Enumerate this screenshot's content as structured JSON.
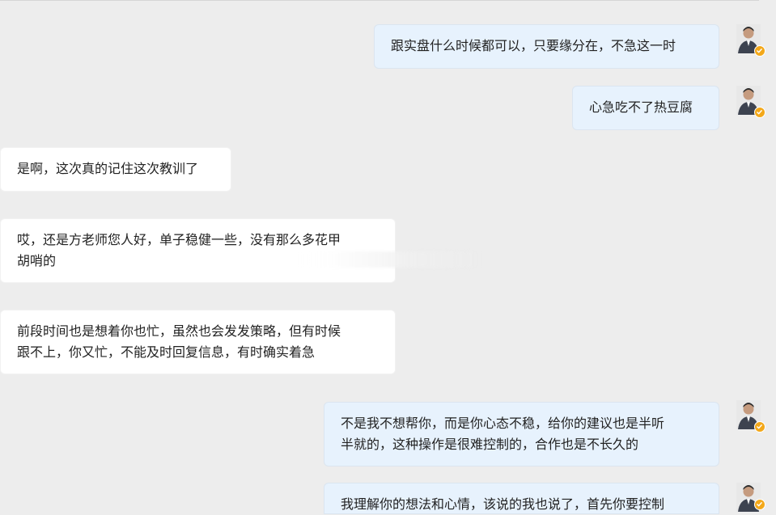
{
  "messages": [
    {
      "side": "out",
      "lines": [
        "跟实盘什么时候都可以，只要缘分在，不急这一时"
      ]
    },
    {
      "side": "out",
      "lines": [
        "心急吃不了热豆腐"
      ]
    },
    {
      "side": "in",
      "lines": [
        "是啊，这次真的记住这次教训了"
      ]
    },
    {
      "side": "in",
      "lines": [
        "哎，还是方老师您人好，单子稳健一些，没有那么多花甲",
        "胡哨的"
      ]
    },
    {
      "side": "in",
      "lines": [
        "前段时间也是想着你也忙，虽然也会发发策略，但有时候",
        "跟不上，你又忙，不能及时回复信息，有时确实着急"
      ]
    },
    {
      "side": "out",
      "lines": [
        "不是我不想帮你，而是你心态不稳，给你的建议也是半听",
        "半就的，这种操作是很难控制的，合作也是不长久的"
      ]
    },
    {
      "side": "out",
      "lines": [
        "我理解你的想法和心情，该说的我也说了，首先你要控制"
      ]
    }
  ],
  "colors": {
    "background": "#ededed",
    "incoming": "#ffffff",
    "outgoing": "#e7f2fd",
    "badge": "#f3a81a"
  }
}
